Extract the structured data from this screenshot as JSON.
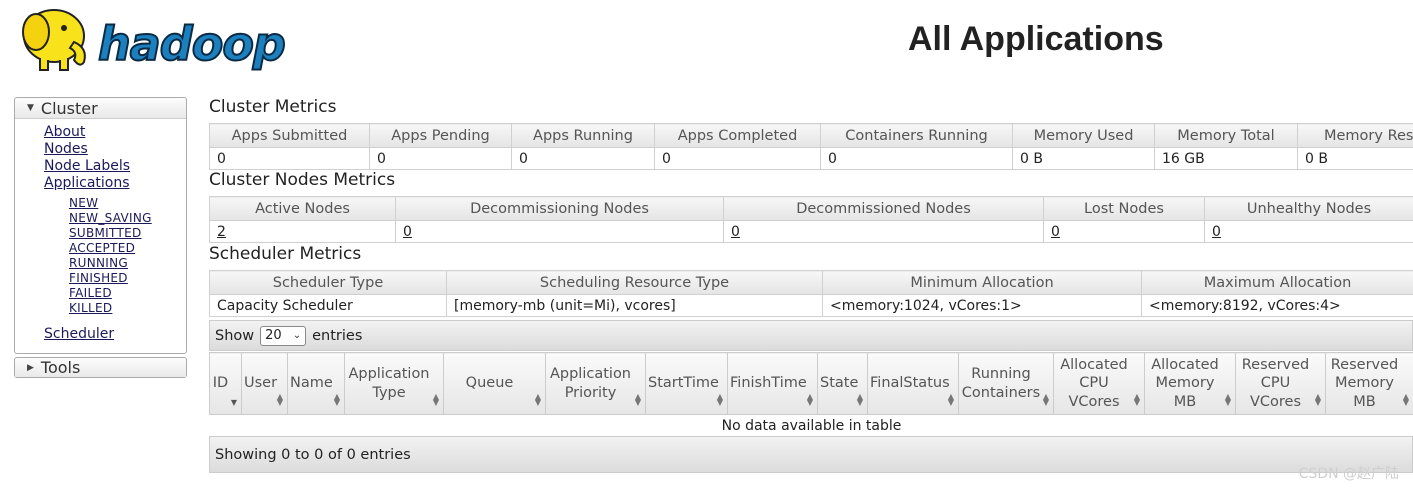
{
  "header": {
    "title": "All Applications",
    "logo_text": "hadoop"
  },
  "sidebar": {
    "cluster_label": "Cluster",
    "tools_label": "Tools",
    "links": [
      "About",
      "Nodes",
      "Node Labels",
      "Applications"
    ],
    "app_states": [
      "NEW",
      "NEW_SAVING",
      "SUBMITTED",
      "ACCEPTED",
      "RUNNING",
      "FINISHED",
      "FAILED",
      "KILLED"
    ],
    "scheduler_label": "Scheduler"
  },
  "cluster_metrics": {
    "title": "Cluster Metrics",
    "headers": [
      "Apps Submitted",
      "Apps Pending",
      "Apps Running",
      "Apps Completed",
      "Containers Running",
      "Memory Used",
      "Memory Total",
      "Memory Rese"
    ],
    "values": [
      "0",
      "0",
      "0",
      "0",
      "0",
      "0 B",
      "16 GB",
      "0 B"
    ]
  },
  "nodes_metrics": {
    "title": "Cluster Nodes Metrics",
    "headers": [
      "Active Nodes",
      "Decommissioning Nodes",
      "Decommissioned Nodes",
      "Lost Nodes",
      "Unhealthy Nodes"
    ],
    "values": [
      "2",
      "0",
      "0",
      "0",
      "0"
    ]
  },
  "scheduler_metrics": {
    "title": "Scheduler Metrics",
    "headers": [
      "Scheduler Type",
      "Scheduling Resource Type",
      "Minimum Allocation",
      "Maximum Allocation"
    ],
    "values": [
      "Capacity Scheduler",
      "[memory-mb (unit=Mi), vcores]",
      "<memory:1024, vCores:1>",
      "<memory:8192, vCores:4>"
    ]
  },
  "apps_table": {
    "show_label": "Show",
    "entries_label": "entries",
    "page_length": "20",
    "columns": [
      "ID",
      "User",
      "Name",
      "Application Type",
      "Queue",
      "Application Priority",
      "StartTime",
      "FinishTime",
      "State",
      "FinalStatus",
      "Running Containers",
      "Allocated CPU VCores",
      "Allocated Memory MB",
      "Reserved CPU VCores",
      "Reserved Memory MB"
    ],
    "empty_message": "No data available in table",
    "info": "Showing 0 to 0 of 0 entries"
  },
  "watermark": "CSDN @赵广陆",
  "colors": {
    "logo_yellow": "#f7e21b",
    "logo_blue": "#1c7fbe",
    "link": "#1a1a5a"
  }
}
